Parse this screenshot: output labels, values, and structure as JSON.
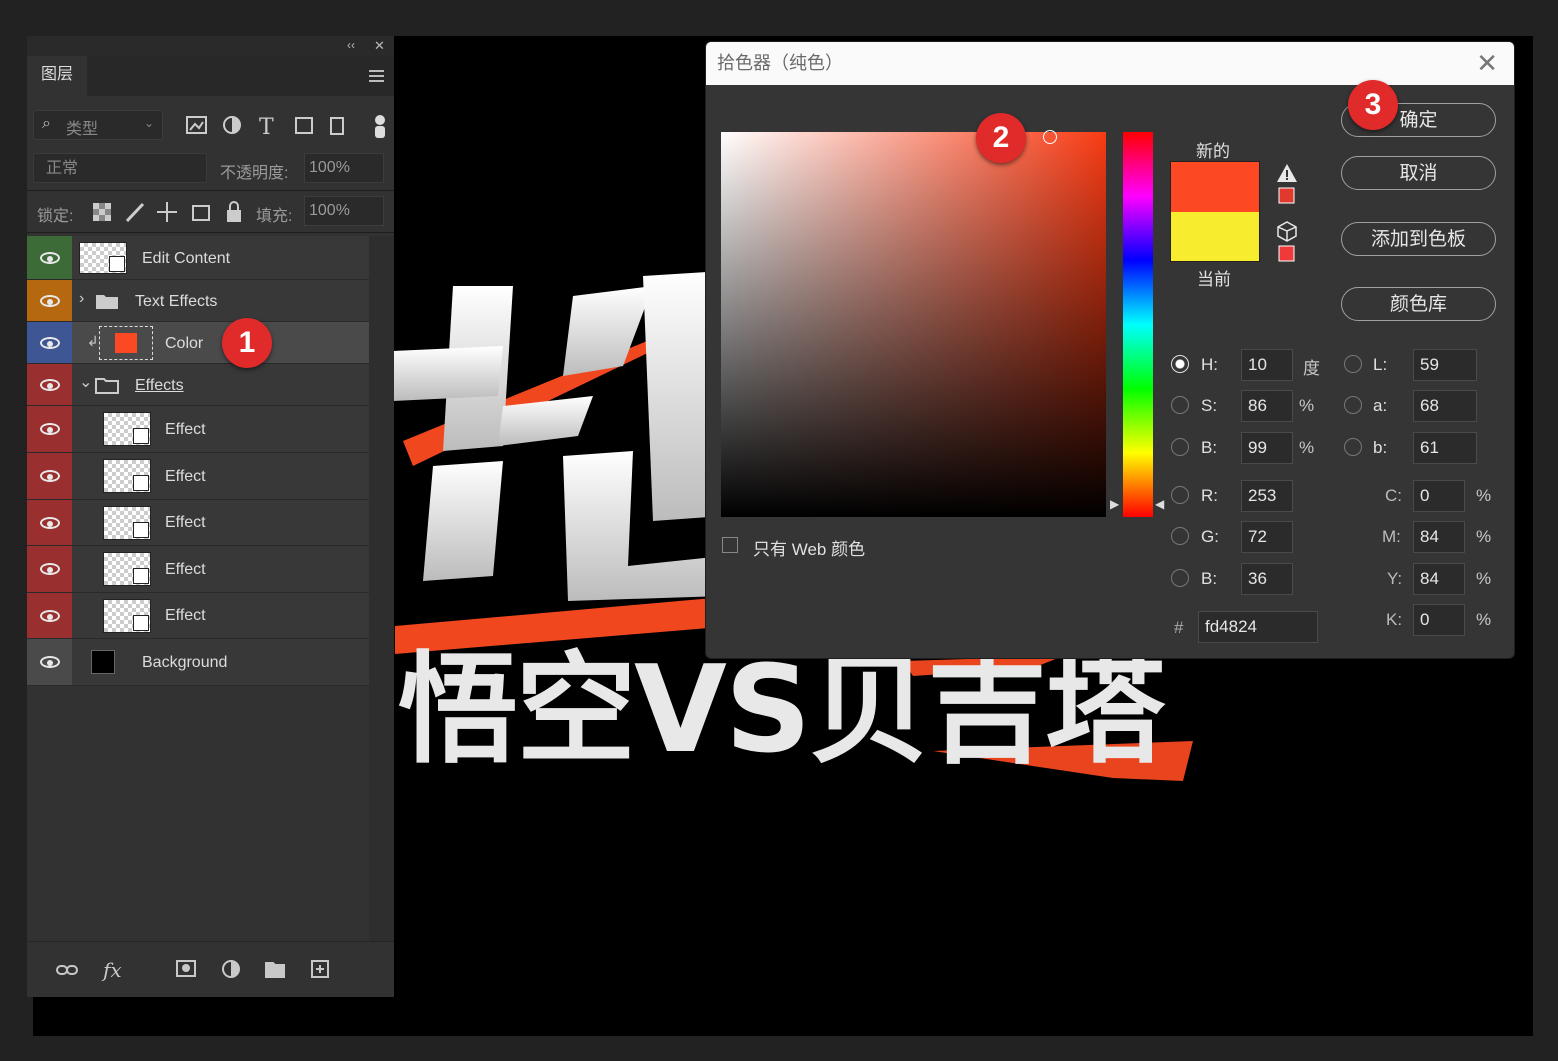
{
  "layers_panel": {
    "tab": "图层",
    "collapse_glyph": "‹‹",
    "close_glyph": "✕",
    "filter_placeholder": "类型",
    "blend_mode": "正常",
    "opacity_label": "不透明度:",
    "opacity_value": "100%",
    "lock_label": "锁定:",
    "fill_label": "填充:",
    "fill_value": "100%",
    "layers": [
      {
        "name": "Edit Content",
        "color": "#3d6b38"
      },
      {
        "name": "Text Effects",
        "color": "#b5680f"
      },
      {
        "name": "Color",
        "color": "#3f5694"
      },
      {
        "name": "Effects",
        "color": "#9a2f2f"
      },
      {
        "name": "Effect",
        "color": "#9a2f2f"
      },
      {
        "name": "Effect",
        "color": "#9a2f2f"
      },
      {
        "name": "Effect",
        "color": "#9a2f2f"
      },
      {
        "name": "Effect",
        "color": "#9a2f2f"
      },
      {
        "name": "Effect",
        "color": "#9a2f2f"
      },
      {
        "name": "Background",
        "color": "#4a4a4a"
      }
    ]
  },
  "canvas_text": {
    "line2": "悟空VS贝吉塔"
  },
  "markers": [
    "1",
    "2",
    "3"
  ],
  "color_picker": {
    "title": "拾色器（纯色）",
    "close_glyph": "✕",
    "new_label": "新的",
    "current_label": "当前",
    "new_color": "#fd4824",
    "current_color": "#f7ed2e",
    "web_only_label": "只有 Web 颜色",
    "buttons": {
      "ok": "确定",
      "cancel": "取消",
      "add_swatch": "添加到色板",
      "color_library": "颜色库"
    },
    "hsb": {
      "h_label": "H:",
      "h": "10",
      "h_unit": "度",
      "s_label": "S:",
      "s": "86",
      "s_unit": "%",
      "b_label": "B:",
      "b": "99",
      "b_unit": "%"
    },
    "lab": {
      "l_label": "L:",
      "l": "59",
      "a_label": "a:",
      "a": "68",
      "b_label": "b:",
      "b": "61"
    },
    "rgb": {
      "r_label": "R:",
      "r": "253",
      "g_label": "G:",
      "g": "72",
      "b_label": "B:",
      "b": "36"
    },
    "cmyk": {
      "c_label": "C:",
      "c": "0",
      "m_label": "M:",
      "m": "84",
      "y_label": "Y:",
      "y": "84",
      "k_label": "K:",
      "k": "0",
      "unit": "%"
    },
    "hex_label": "#",
    "hex": "fd4824"
  }
}
